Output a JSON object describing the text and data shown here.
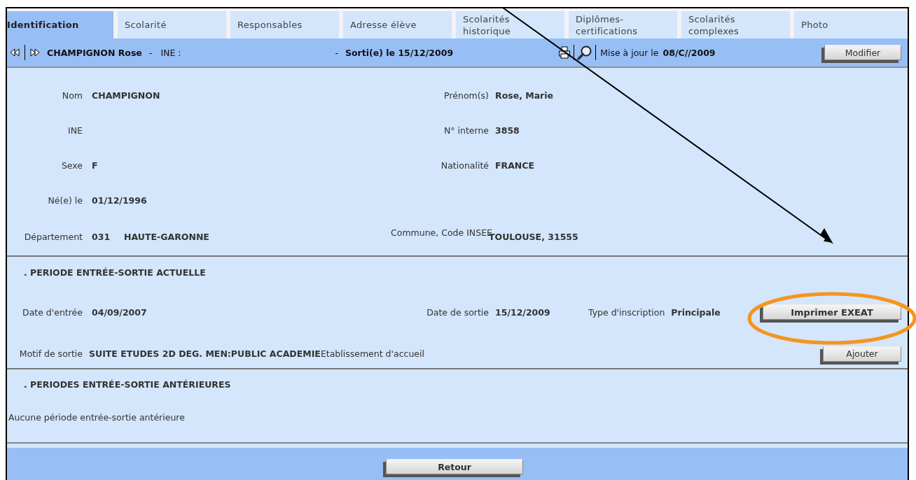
{
  "tabs": [
    {
      "lines": [
        "Identification"
      ],
      "selected": true
    },
    {
      "lines": [
        "Scolarité"
      ],
      "selected": false
    },
    {
      "lines": [
        "Responsables"
      ],
      "selected": false
    },
    {
      "lines": [
        "Adresse élève"
      ],
      "selected": false
    },
    {
      "lines": [
        "Scolarités",
        "historique"
      ],
      "selected": false
    },
    {
      "lines": [
        "Diplômes-",
        "certifications"
      ],
      "selected": false
    },
    {
      "lines": [
        "Scolarités",
        "complexes"
      ],
      "selected": false
    },
    {
      "lines": [
        "Photo"
      ],
      "selected": false
    }
  ],
  "header": {
    "student": "CHAMPIGNON Rose",
    "separator_1": "-",
    "ine_label": "INE :",
    "separator_2": "-",
    "exit": "Sorti(e) le 15/12/2009",
    "update_label": "Mise à jour le",
    "update_date": "08/C//2009",
    "button": "Modifier"
  },
  "identity": {
    "rows": [
      [
        {
          "label": "Nom",
          "values": [
            "CHAMPIGNON"
          ]
        },
        {
          "label": "Prénom(s)",
          "values": [
            "Rose, Marie"
          ]
        }
      ],
      [
        {
          "label": "INE"
        },
        {
          "label": "N° interne",
          "values": [
            "3858"
          ]
        }
      ],
      [
        {
          "label": "Sexe",
          "values": [
            "F"
          ]
        },
        {
          "label": "Nationalité",
          "values": [
            "FRANCE"
          ]
        }
      ],
      [
        {
          "label": "Né(e) le",
          "values": [
            "01/12/1996"
          ]
        }
      ],
      [
        {
          "label": "Département",
          "values": [
            "031",
            "HAUTE-GARONNE"
          ]
        },
        {
          "label": "Commune, Code INSEE",
          "values": [
            "TOULOUSE, 31555"
          ]
        }
      ]
    ]
  },
  "current_period": {
    "title": ". PERIODE ENTRÉE-SORTIE ACTUELLE",
    "row_1": {
      "entry": {
        "label": "Date d'entrée",
        "value": "04/09/2007"
      },
      "exit": {
        "label": "Date de sortie",
        "value": "15/12/2009"
      },
      "type": {
        "label": "Type d'inscription",
        "value": "Principale"
      },
      "button": "Imprimer EXEAT"
    },
    "row_2": {
      "reason": {
        "label": "Motif de sortie",
        "value": "SUITE ETUDES 2D DEG. MEN:PUBLIC ACADEMIE"
      },
      "school_label": "Etablissement d'accueil",
      "button": "Ajouter"
    }
  },
  "previous_periods": {
    "title": ". PERIODES ENTRÉE-SORTIE ANTÉRIEURES",
    "message": "Aucune période entrée-sortie antérieure"
  },
  "footer": {
    "button": "Retour"
  }
}
